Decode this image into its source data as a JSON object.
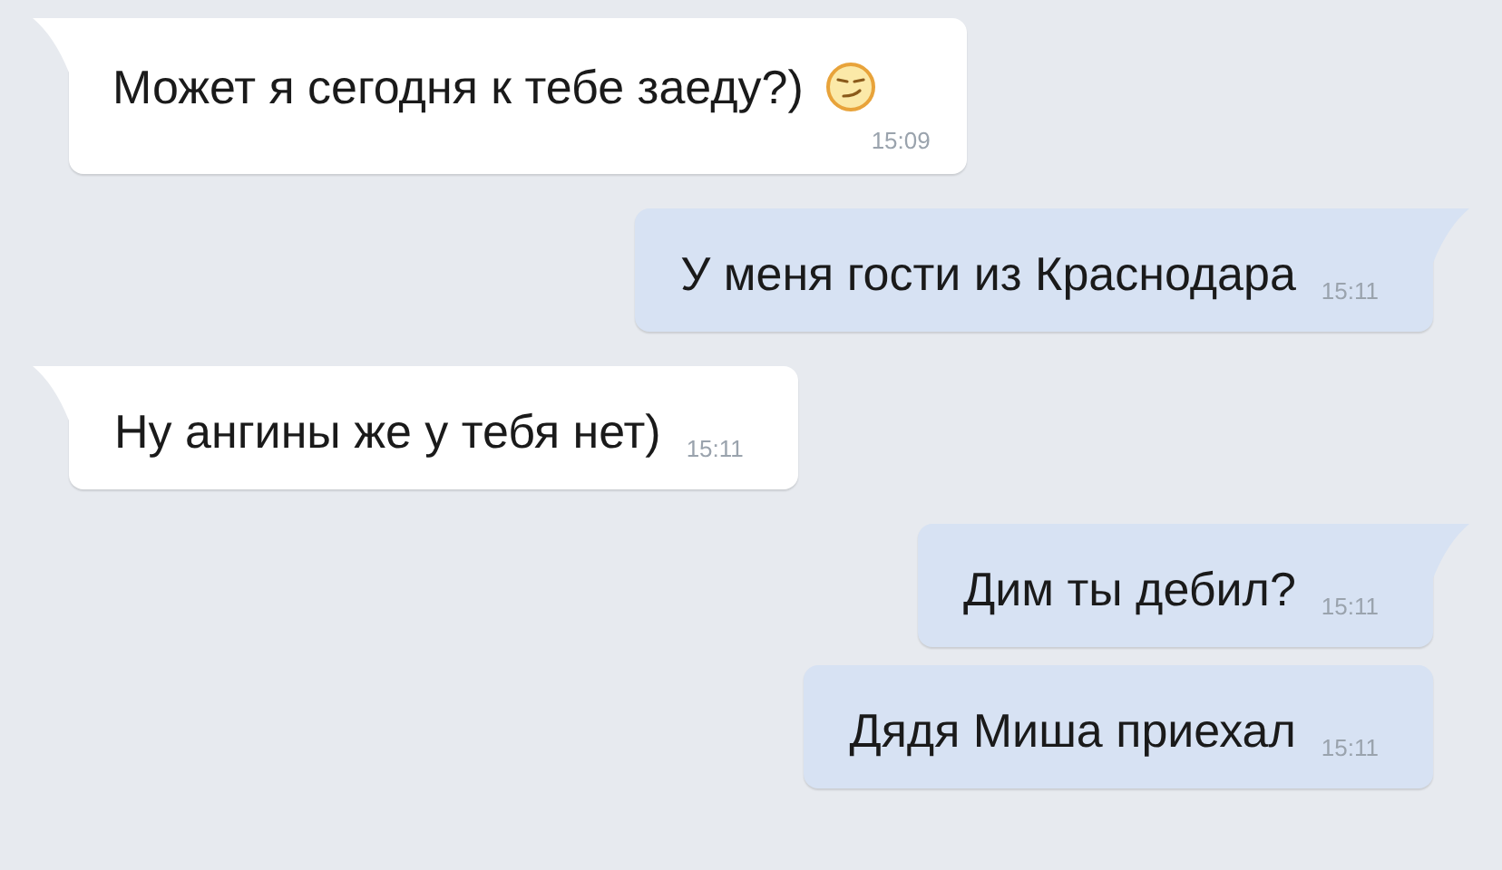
{
  "messages": [
    {
      "kind": "incoming",
      "text": "Может я сегодня к тебе заеду?)",
      "has_emoji": true,
      "time": "15:09",
      "tail": true
    },
    {
      "kind": "outgoing",
      "text": "У меня гости из Краснодара",
      "has_emoji": false,
      "time": "15:11",
      "tail": true
    },
    {
      "kind": "incoming",
      "text": "Ну ангины же у тебя нет)",
      "has_emoji": false,
      "time": "15:11",
      "tail": true
    },
    {
      "kind": "outgoing",
      "text": "Дим ты дебил?",
      "has_emoji": false,
      "time": "15:11",
      "tail": true
    },
    {
      "kind": "outgoing",
      "text": "Дядя Миша приехал",
      "has_emoji": false,
      "time": "15:11",
      "tail": false
    }
  ]
}
